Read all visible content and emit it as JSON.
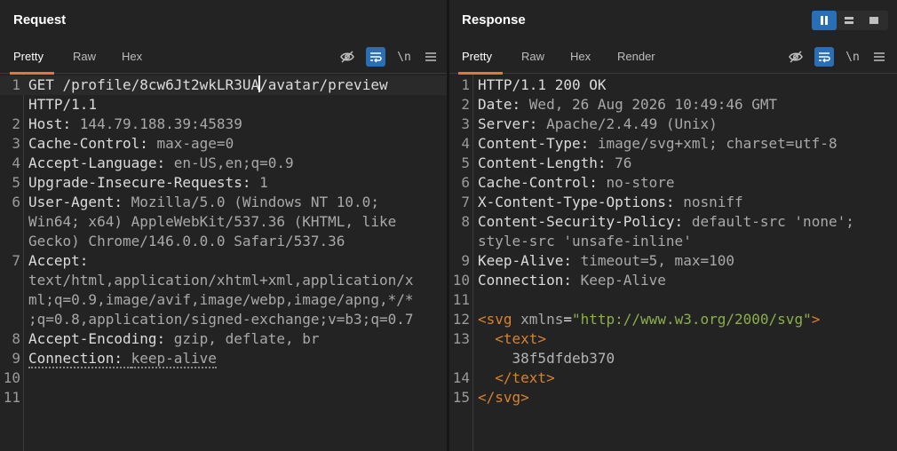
{
  "request": {
    "title": "Request",
    "tabs": [
      {
        "label": "Pretty",
        "active": true
      },
      {
        "label": "Raw",
        "active": false
      },
      {
        "label": "Hex",
        "active": false
      }
    ],
    "tools": {
      "newline_label": "\\n"
    },
    "lines": [
      {
        "num": "1",
        "parts": [
          {
            "t": "GET /profile/8cw6Jt2wkLR3UA",
            "c": "key"
          },
          {
            "caret": true
          },
          {
            "t": "/avatar/preview",
            "c": "key"
          }
        ]
      },
      {
        "num": "",
        "parts": [
          {
            "t": "HTTP/1.1",
            "c": "key"
          }
        ]
      },
      {
        "num": "2",
        "parts": [
          {
            "t": "Host: ",
            "c": "key"
          },
          {
            "t": "144.79.188.39:45839",
            "c": "val"
          }
        ]
      },
      {
        "num": "3",
        "parts": [
          {
            "t": "Cache-Control: ",
            "c": "key"
          },
          {
            "t": "max-age=0",
            "c": "val"
          }
        ]
      },
      {
        "num": "4",
        "parts": [
          {
            "t": "Accept-Language: ",
            "c": "key"
          },
          {
            "t": "en-US,en;q=0.9",
            "c": "val"
          }
        ]
      },
      {
        "num": "5",
        "parts": [
          {
            "t": "Upgrade-Insecure-Requests: ",
            "c": "key"
          },
          {
            "t": "1",
            "c": "val"
          }
        ]
      },
      {
        "num": "6",
        "parts": [
          {
            "t": "User-Agent: ",
            "c": "key"
          },
          {
            "t": "Mozilla/5.0 (Windows NT 10.0;",
            "c": "val"
          }
        ]
      },
      {
        "num": "",
        "parts": [
          {
            "t": "Win64; x64) AppleWebKit/537.36 (KHTML, like",
            "c": "val"
          }
        ]
      },
      {
        "num": "",
        "parts": [
          {
            "t": "Gecko) Chrome/146.0.0.0 Safari/537.36",
            "c": "val"
          }
        ]
      },
      {
        "num": "7",
        "parts": [
          {
            "t": "Accept:",
            "c": "key"
          }
        ]
      },
      {
        "num": "",
        "parts": [
          {
            "t": "text/html,application/xhtml+xml,application/x",
            "c": "val"
          }
        ]
      },
      {
        "num": "",
        "parts": [
          {
            "t": "ml;q=0.9,image/avif,image/webp,image/apng,*/*",
            "c": "val"
          }
        ]
      },
      {
        "num": "",
        "parts": [
          {
            "t": ";q=0.8,application/signed-exchange;v=b3;q=0.7",
            "c": "val"
          }
        ]
      },
      {
        "num": "8",
        "parts": [
          {
            "t": "Accept-Encoding: ",
            "c": "key"
          },
          {
            "t": "gzip, deflate, br",
            "c": "val"
          }
        ]
      },
      {
        "num": "9",
        "parts": [
          {
            "t": "Connection: ",
            "c": "key",
            "u": true
          },
          {
            "t": "keep-alive",
            "c": "val",
            "u": true
          }
        ]
      },
      {
        "num": "10",
        "parts": []
      },
      {
        "num": "11",
        "parts": []
      }
    ]
  },
  "response": {
    "title": "Response",
    "tabs": [
      {
        "label": "Pretty",
        "active": true
      },
      {
        "label": "Raw",
        "active": false
      },
      {
        "label": "Hex",
        "active": false
      },
      {
        "label": "Render",
        "active": false
      }
    ],
    "tools": {
      "newline_label": "\\n"
    },
    "lines": [
      {
        "num": "1",
        "parts": [
          {
            "t": "HTTP/1.1 200 OK",
            "c": "key"
          }
        ]
      },
      {
        "num": "2",
        "parts": [
          {
            "t": "Date: ",
            "c": "key"
          },
          {
            "t": "Wed, 26 Aug 2026 10:49:46 GMT",
            "c": "val"
          }
        ]
      },
      {
        "num": "3",
        "parts": [
          {
            "t": "Server: ",
            "c": "key"
          },
          {
            "t": "Apache/2.4.49 (Unix)",
            "c": "val"
          }
        ]
      },
      {
        "num": "4",
        "parts": [
          {
            "t": "Content-Type: ",
            "c": "key"
          },
          {
            "t": "image/svg+xml; charset=utf-8",
            "c": "val"
          }
        ]
      },
      {
        "num": "5",
        "parts": [
          {
            "t": "Content-Length: ",
            "c": "key"
          },
          {
            "t": "76",
            "c": "val"
          }
        ]
      },
      {
        "num": "6",
        "parts": [
          {
            "t": "Cache-Control: ",
            "c": "key"
          },
          {
            "t": "no-store",
            "c": "val"
          }
        ]
      },
      {
        "num": "7",
        "parts": [
          {
            "t": "X-Content-Type-Options: ",
            "c": "key"
          },
          {
            "t": "nosniff",
            "c": "val"
          }
        ]
      },
      {
        "num": "8",
        "parts": [
          {
            "t": "Content-Security-Policy: ",
            "c": "key"
          },
          {
            "t": "default-src 'none';",
            "c": "val"
          }
        ]
      },
      {
        "num": "",
        "parts": [
          {
            "t": "style-src 'unsafe-inline'",
            "c": "val"
          }
        ]
      },
      {
        "num": "9",
        "parts": [
          {
            "t": "Keep-Alive: ",
            "c": "key"
          },
          {
            "t": "timeout=5, max=100",
            "c": "val"
          }
        ]
      },
      {
        "num": "10",
        "parts": [
          {
            "t": "Connection: ",
            "c": "key"
          },
          {
            "t": "Keep-Alive",
            "c": "val"
          }
        ]
      },
      {
        "num": "11",
        "parts": []
      },
      {
        "num": "12",
        "parts": [
          {
            "t": "<svg ",
            "c": "tagc"
          },
          {
            "t": "xmlns",
            "c": "attr"
          },
          {
            "t": "=",
            "c": "key"
          },
          {
            "t": "\"http://www.w3.org/2000/svg\"",
            "c": "str"
          },
          {
            "t": ">",
            "c": "tagc"
          }
        ]
      },
      {
        "num": "13",
        "parts": [
          {
            "t": "  <text>",
            "c": "tagc"
          }
        ]
      },
      {
        "num": "",
        "parts": [
          {
            "t": "    38f5dfdeb370",
            "c": "txt"
          }
        ]
      },
      {
        "num": "14",
        "parts": [
          {
            "t": "  </text>",
            "c": "tagc"
          }
        ]
      },
      {
        "num": "15",
        "parts": [
          {
            "t": "</svg>",
            "c": "tagc"
          }
        ]
      }
    ]
  },
  "colors": {
    "accent_tab": "#e8743b",
    "button_blue": "#2a6fb6",
    "xml_tag": "#d9822b",
    "xml_string": "#8bb04a"
  }
}
